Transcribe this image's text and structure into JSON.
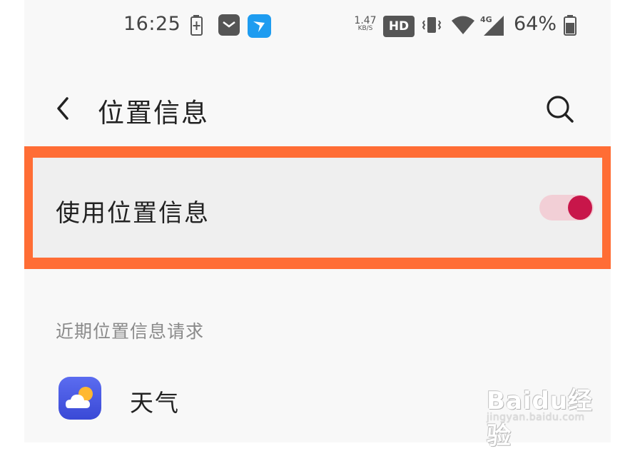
{
  "status_bar": {
    "time": "16:25",
    "network_speed_value": "1.47",
    "network_speed_unit": "KB/S",
    "hd_badge": "HD",
    "network_type": "4G",
    "battery_percent": "64%",
    "icons": [
      "battery-charging-icon",
      "mail-icon",
      "app-notification-icon",
      "vibrate-icon",
      "wifi-icon",
      "signal-icon",
      "battery-icon"
    ]
  },
  "header": {
    "title": "位置信息",
    "back_icon": "chevron-left-icon",
    "search_icon": "search-icon"
  },
  "location_setting": {
    "label": "使用位置信息",
    "toggle_on": true,
    "toggle_color": "#c8164a",
    "highlight_color": "#ff6d35"
  },
  "recent_requests": {
    "section_title": "近期位置信息请求",
    "apps": [
      {
        "name": "天气",
        "icon": "weather-app-icon"
      }
    ]
  },
  "watermark": {
    "logo": "Baidu经验",
    "url": "jingyan.baidu.com"
  }
}
